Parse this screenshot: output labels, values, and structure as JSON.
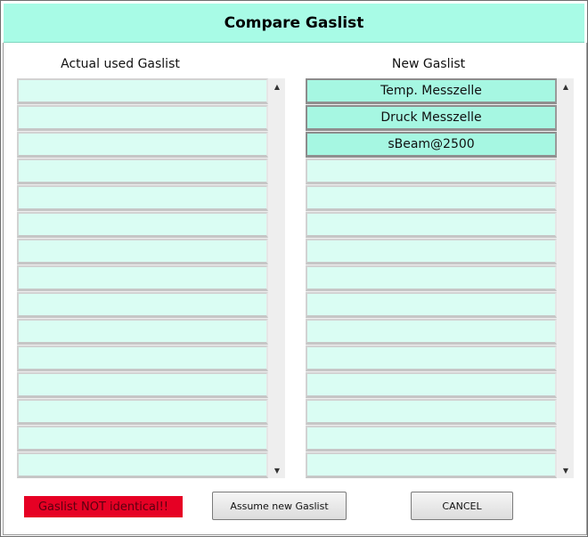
{
  "window": {
    "title": "Compare Gaslist"
  },
  "left_list": {
    "header": "Actual used Gaslist",
    "rows": [
      "",
      "",
      "",
      "",
      "",
      "",
      "",
      "",
      "",
      "",
      "",
      "",
      "",
      "",
      ""
    ]
  },
  "right_list": {
    "header": "New Gaslist",
    "rows": [
      "Temp. Messzelle",
      "Druck Messzelle",
      "sBeam@2500",
      "",
      "",
      "",
      "",
      "",
      "",
      "",
      "",
      "",
      "",
      "",
      ""
    ]
  },
  "status": {
    "text": "Gaslist NOT identical!!"
  },
  "buttons": {
    "assume": "Assume new Gaslist",
    "cancel": "CANCEL"
  },
  "colors": {
    "title_bar": "#a8fbe6",
    "row_empty": "#dafdf3",
    "row_filled": "#a6f7e2",
    "status_bg": "#e60024"
  },
  "icons": {
    "scroll_up": "triangle-up-icon",
    "scroll_down": "triangle-down-icon"
  }
}
